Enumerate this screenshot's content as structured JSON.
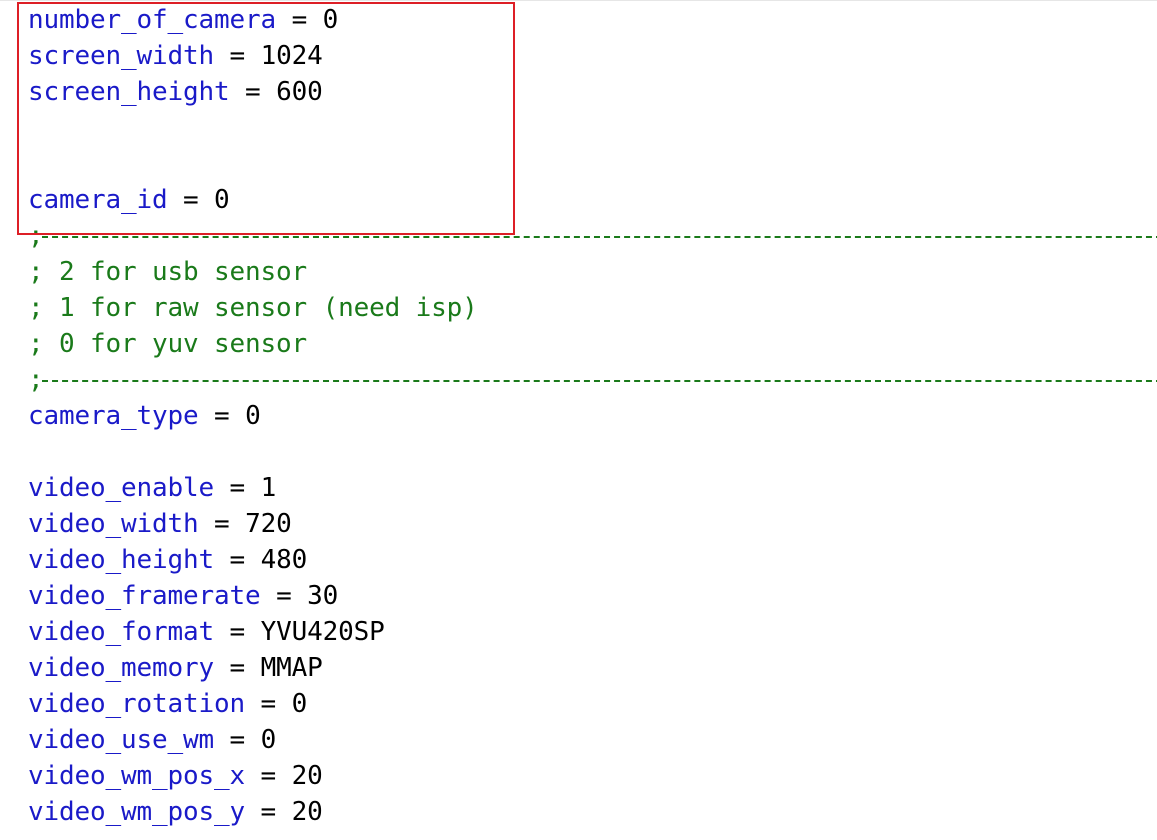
{
  "annotation": {
    "box_color": "#dd1f26"
  },
  "colors": {
    "key": "#1a1ac8",
    "value": "#000000",
    "comment": "#1a7a1a"
  },
  "lines": [
    {
      "kind": "kv",
      "key": "number_of_camera",
      "eq": " = ",
      "value": "0"
    },
    {
      "kind": "kv",
      "key": "screen_width",
      "eq": " = ",
      "value": "1024"
    },
    {
      "kind": "kv",
      "key": "screen_height",
      "eq": " = ",
      "value": "600"
    },
    {
      "kind": "blank"
    },
    {
      "kind": "blank"
    },
    {
      "kind": "kv",
      "key": "camera_id",
      "eq": " = ",
      "value": "0"
    },
    {
      "kind": "separator",
      "text": ";"
    },
    {
      "kind": "comment",
      "text": "; 2 for usb sensor"
    },
    {
      "kind": "comment",
      "text": "; 1 for raw sensor (need isp)"
    },
    {
      "kind": "comment",
      "text": "; 0 for yuv sensor"
    },
    {
      "kind": "separator",
      "text": ";"
    },
    {
      "kind": "kv",
      "key": "camera_type",
      "eq": " = ",
      "value": "0"
    },
    {
      "kind": "blank"
    },
    {
      "kind": "kv",
      "key": "video_enable",
      "eq": " = ",
      "value": "1"
    },
    {
      "kind": "kv",
      "key": "video_width",
      "eq": " = ",
      "value": "720"
    },
    {
      "kind": "kv",
      "key": "video_height",
      "eq": " = ",
      "value": "480"
    },
    {
      "kind": "kv",
      "key": "video_framerate",
      "eq": " = ",
      "value": "30"
    },
    {
      "kind": "kv",
      "key": "video_format",
      "eq": " = ",
      "value": "YVU420SP"
    },
    {
      "kind": "kv",
      "key": "video_memory",
      "eq": " = ",
      "value": "MMAP"
    },
    {
      "kind": "kv",
      "key": "video_rotation",
      "eq": " = ",
      "value": "0"
    },
    {
      "kind": "kv",
      "key": "video_use_wm",
      "eq": " = ",
      "value": "0"
    },
    {
      "kind": "kv",
      "key": "video_wm_pos_x",
      "eq": " = ",
      "value": "20"
    },
    {
      "kind": "kv",
      "key": "video_wm_pos_y",
      "eq": " = ",
      "value": "20"
    }
  ]
}
